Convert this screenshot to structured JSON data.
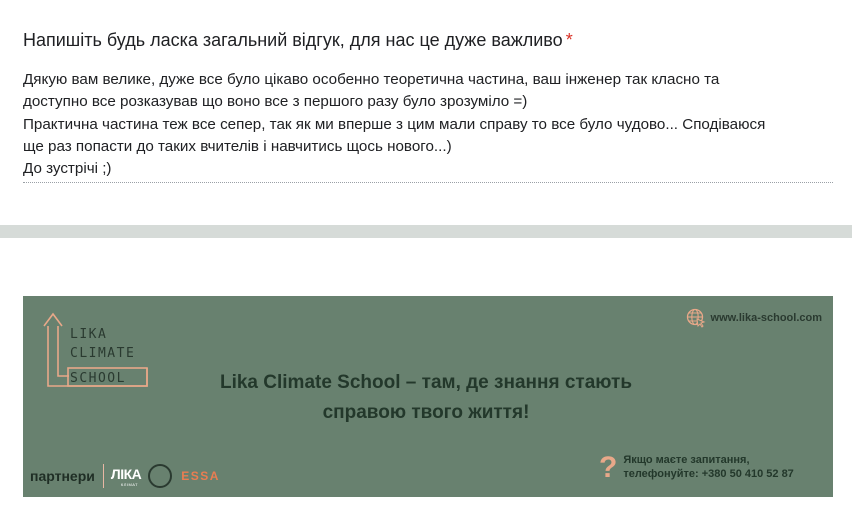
{
  "question": {
    "title": "Напишіть будь ласка загальний відгук, для нас це дуже важливо",
    "required_mark": "*"
  },
  "answer": {
    "lines": [
      "Дякую вам велике, дуже все було цікаво особенно теоретична частина, ваш інженер так класно та",
      "доступно все розказував що воно все з першого разу було зрозуміло =)",
      "Практична частина теж все сепер, так як ми вперше з цим мали справу то все було чудово... Сподіваюся",
      "ще раз попасти до таких вчителів і навчитись щось нового...)",
      "До зустрічі ;)"
    ]
  },
  "banner": {
    "logo": {
      "line1": "LIKA",
      "line2": "CLIMATE",
      "line3": "SCHOOL"
    },
    "website": "www.lika-school.com",
    "slogan_line1": "Lika Climate School – там, де знання стають",
    "slogan_line2": "справою твого життя!",
    "partners_label": "партнери",
    "partner1": "ЛІКА",
    "partner1_sub": "КЛІМАТ",
    "partner3": "ESSA",
    "contact_line1": "Якщо маєте запитання,",
    "contact_line2": "телефонуйте: +380 50 410 52 87",
    "colors": {
      "background": "#68816f",
      "accent": "#e8a889",
      "text": "#23382b"
    },
    "icons": [
      "logo-arrow-icon",
      "globe-cursor-icon",
      "question-mark-icon",
      "ring-logo-icon"
    ]
  }
}
